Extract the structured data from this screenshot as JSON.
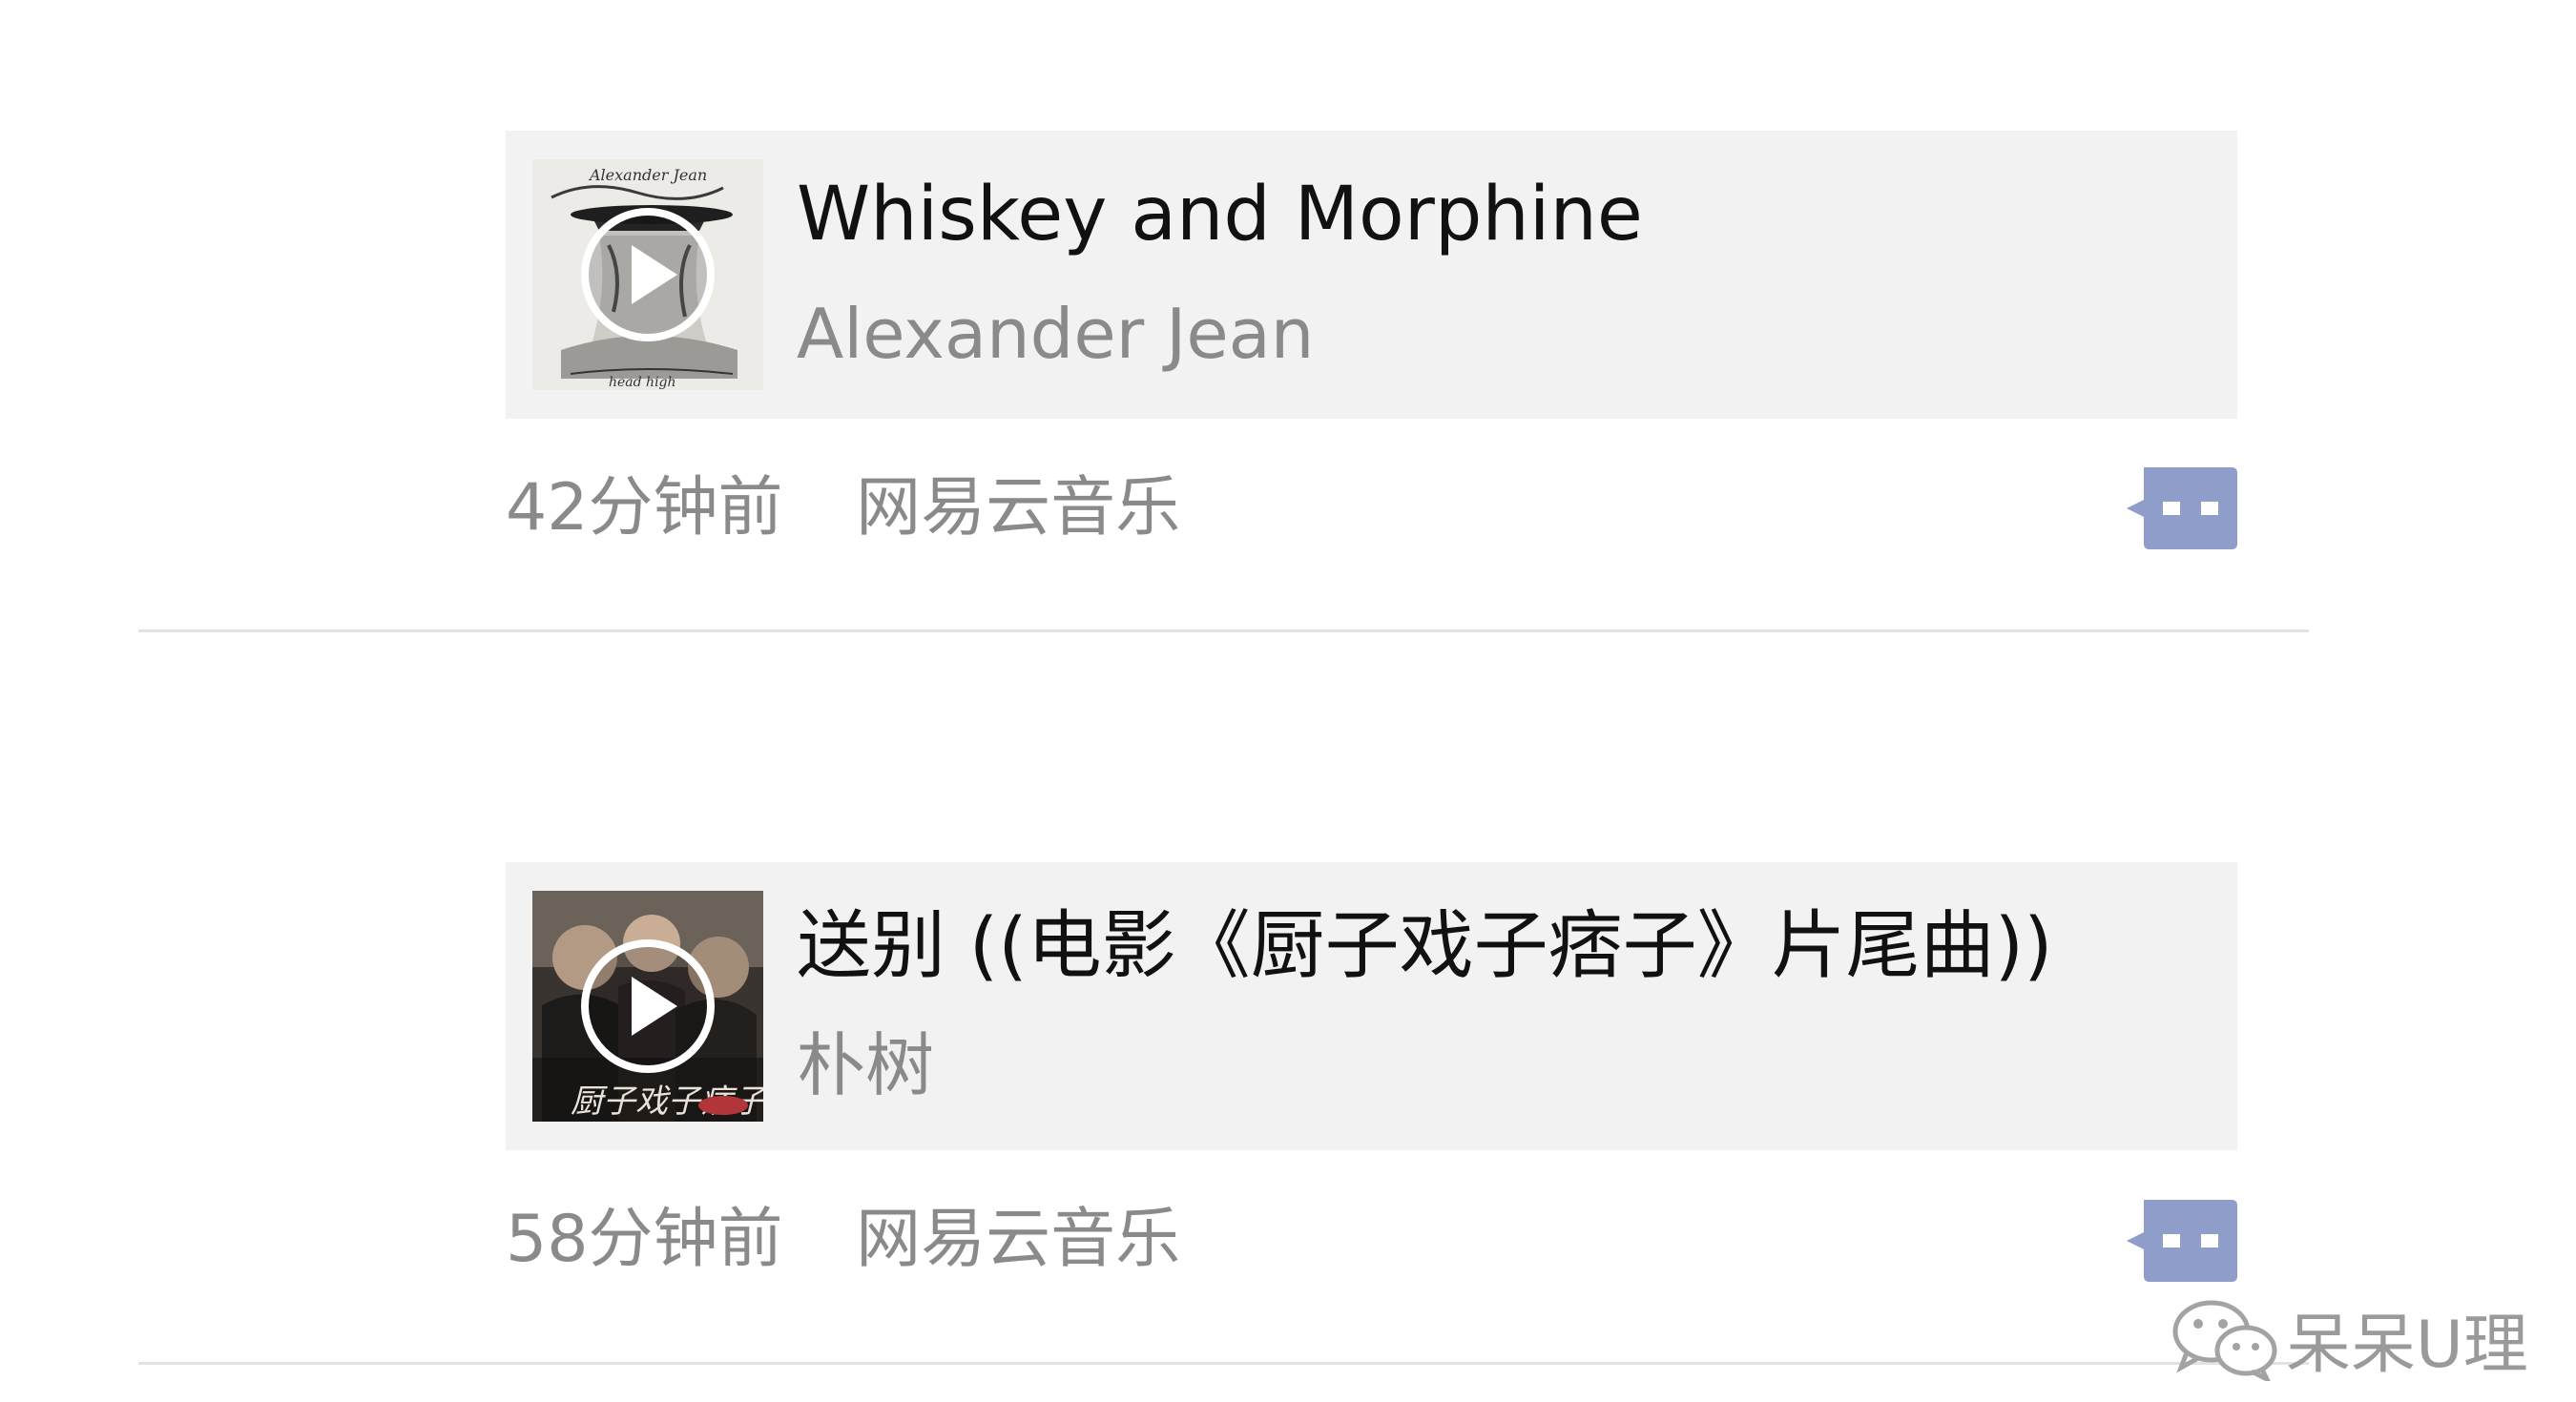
{
  "feed": {
    "posts": [
      {
        "title": "Whiskey and Morphine",
        "artist": "Alexander Jean",
        "time": "42分钟前",
        "source": "网易云音乐",
        "cover_text_top": "Alexander Jean",
        "cover_text_bottom": "head high"
      },
      {
        "title": "送别 ((电影《厨子戏子痞子》片尾曲))",
        "artist": "朴树",
        "time": "58分钟前",
        "source": "网易云音乐",
        "cover_text_bottom": "厨子戏子痞子"
      }
    ]
  },
  "watermark": {
    "text": "呆呆U理"
  },
  "colors": {
    "card_bg": "#f2f2f2",
    "meta_text": "#8a8a8a",
    "comment_icon": "#8e9dc9",
    "divider": "#e3e3e3"
  },
  "icons": {
    "play": "play-circle-icon",
    "comment": "comment-bubble-icon",
    "watermark": "wechat-logo-icon"
  }
}
